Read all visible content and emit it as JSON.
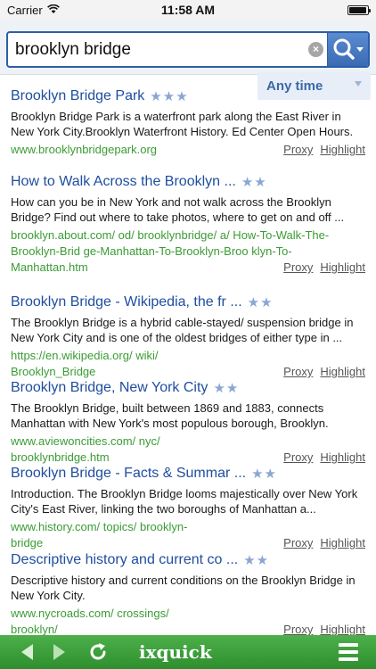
{
  "status_bar": {
    "carrier": "Carrier",
    "time": "11:58 AM",
    "battery_level": 0.95
  },
  "search": {
    "query": "brooklyn bridge",
    "clear_icon": "clear-icon",
    "submit_icon": "search-icon"
  },
  "filter": {
    "time_label": "Any time"
  },
  "results": [
    {
      "title": "Brooklyn Bridge Park",
      "stars": "★★★",
      "desc": "Brooklyn Bridge Park is a waterfront park along the East River in New York City.Brooklyn Waterfront History. Ed Center Open Hours.",
      "url": "www.brooklynbridgepark.org",
      "proxy": "Proxy",
      "highlight": "Highlight"
    },
    {
      "title": "How to Walk Across the Brooklyn ...",
      "stars": "★★",
      "desc": "How can you be in New York and not walk across the Brooklyn Bridge? Find out where to take photos, where to get on and off ...",
      "url": "brooklyn.about.com/ od/ brooklynbridge/ a/ How-To-Walk-The-Brooklyn-Brid ge-Manhattan-To-Brooklyn-Broo klyn-To-Manhattan.htm",
      "proxy": "Proxy",
      "highlight": "Highlight"
    },
    {
      "title": "Brooklyn Bridge - Wikipedia, the fr ...",
      "stars": "★★",
      "desc": "The Brooklyn Bridge is a hybrid cable-stayed/ suspension bridge in New York City and is one of the oldest bridges of either type in ...",
      "url": "https://en.wikipedia.org/ wiki/ Brooklyn_Bridge",
      "proxy": "Proxy",
      "highlight": "Highlight"
    },
    {
      "title": "Brooklyn Bridge, New York City",
      "stars": "★★",
      "desc": "The Brooklyn Bridge, built between 1869 and 1883, connects Manhattan with New York's most populous borough, Brooklyn.",
      "url": "www.aviewoncities.com/ nyc/ brooklynbridge.htm",
      "proxy": "Proxy",
      "highlight": "Highlight"
    },
    {
      "title": "Brooklyn Bridge - Facts & Summar ...",
      "stars": "★★",
      "desc": "Introduction. The Brooklyn Bridge looms majestically over New York City's East River, linking the two boroughs of Manhattan a...",
      "url": "www.history.com/ topics/ brooklyn-bridge",
      "proxy": "Proxy",
      "highlight": "Highlight"
    },
    {
      "title": "Descriptive history and current co ...",
      "stars": "★★",
      "desc": "Descriptive history and current conditions on the Brooklyn Bridge in New York City.",
      "url": "www.nycroads.com/ crossings/ brooklyn/",
      "proxy": "Proxy",
      "highlight": "Highlight"
    }
  ],
  "toolbar": {
    "logo": "ixquick",
    "back_icon": "back-arrow-icon",
    "forward_icon": "forward-arrow-icon",
    "reload_icon": "reload-icon",
    "menu_icon": "menu-icon"
  },
  "colors": {
    "title_blue": "#1f4ea0",
    "url_green": "#3a9c34",
    "toolbar_green": "#3fa23c",
    "search_border": "#2b5fa8"
  }
}
